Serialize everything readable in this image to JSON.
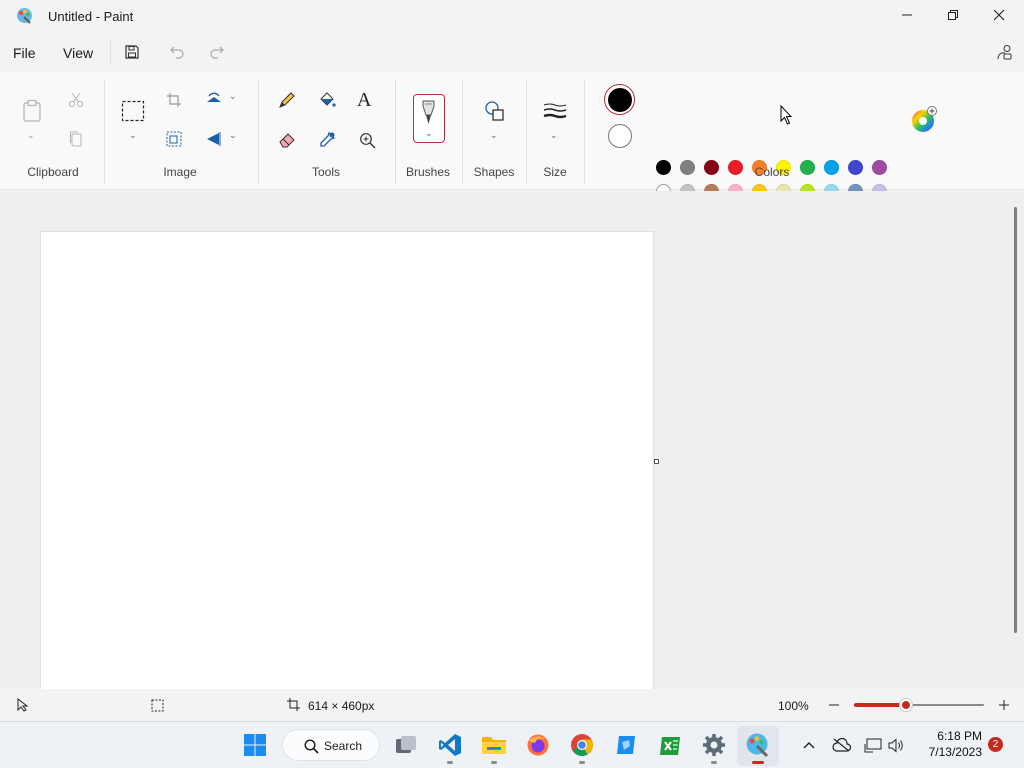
{
  "window": {
    "title": "Untitled - Paint",
    "app_icon": "paint-palette-icon",
    "controls": [
      "minimize-icon",
      "restore-icon",
      "close-icon"
    ]
  },
  "menu": {
    "file": "File",
    "view": "View",
    "save_icon": "save-icon",
    "undo_icon": "undo-icon",
    "redo_icon": "redo-icon",
    "share_icon": "share-icon"
  },
  "ribbon": {
    "groups": {
      "clipboard": "Clipboard",
      "image": "Image",
      "tools": "Tools",
      "brushes": "Brushes",
      "shapes": "Shapes",
      "size": "Size",
      "colors": "Colors"
    },
    "tool_text_glyph": "A",
    "primary_color": "#000000",
    "secondary_color": "#ffffff",
    "palette_row1": [
      "#000000",
      "#7f7f7f",
      "#880015",
      "#ed1c24",
      "#ff7f27",
      "#fff200",
      "#22b14c",
      "#00a2e8",
      "#3f48cc",
      "#a349a4"
    ],
    "palette_row2": [
      "#ffffff",
      "#c3c3c3",
      "#b97a57",
      "#ffaec9",
      "#ffc90e",
      "#efe4b0",
      "#b5e61d",
      "#99d9ea",
      "#7092be",
      "#c8bfe7"
    ],
    "palette_row3_empty_count": 10,
    "accent_color": "#c42b1c"
  },
  "status": {
    "canvas_size": "614 × 460px",
    "zoom": "100%",
    "zoom_fraction": 0.4
  },
  "taskbar": {
    "search_label": "Search",
    "time": "6:18 PM",
    "date": "7/13/2023",
    "notification_count": "2",
    "apps": [
      "start-icon",
      "task-view-icon",
      "vscode-icon",
      "file-explorer-icon",
      "firefox-icon",
      "chrome-icon",
      "remote-app-icon",
      "excel-icon",
      "settings-icon",
      "paint-icon"
    ]
  }
}
